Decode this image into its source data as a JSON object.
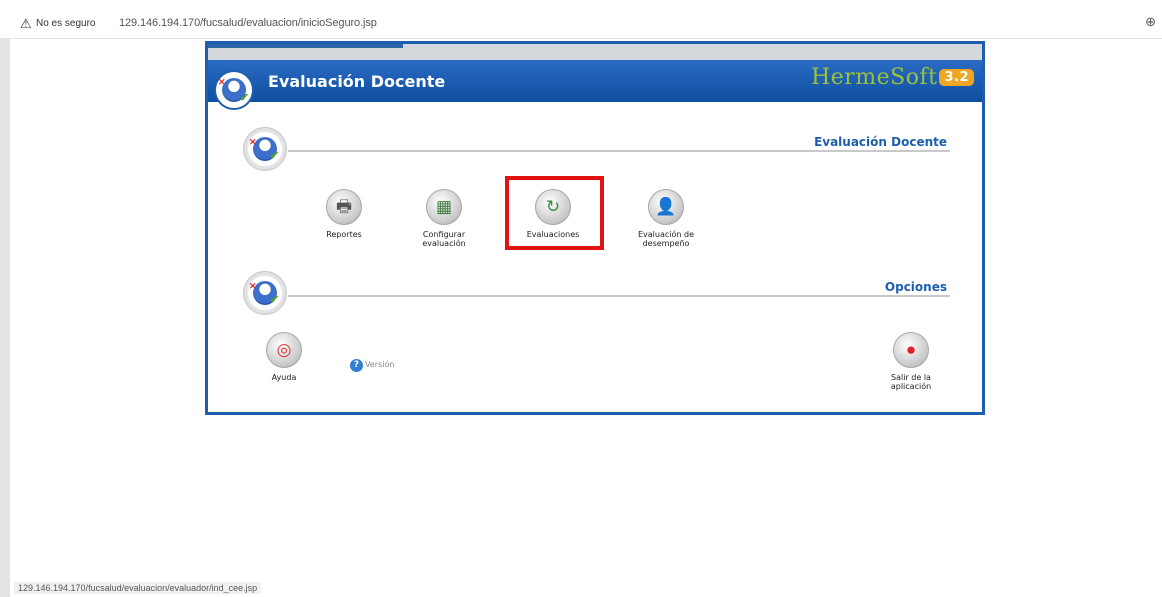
{
  "browser": {
    "security_label": "No es seguro",
    "url": "129.146.194.170/fucsalud/evaluacion/inicioSeguro.jsp",
    "status_url": "129.146.194.170/fucsalud/evaluacion/evaluador/ind_cee.jsp"
  },
  "header": {
    "title": "Evaluación Docente",
    "logo_text": "HermeSoft",
    "logo_version": "3.2"
  },
  "sections": {
    "main_title": "Evaluación Docente",
    "options_title": "Opciones"
  },
  "main_items": [
    {
      "label_line1": "Reportes",
      "label_line2": "",
      "icon": "printer-icon"
    },
    {
      "label_line1": "Configurar",
      "label_line2": "evaluación",
      "icon": "config-icon"
    },
    {
      "label_line1": "Evaluaciones",
      "label_line2": "",
      "icon": "evaluations-icon"
    },
    {
      "label_line1": "Evaluación de",
      "label_line2": "desempeño",
      "icon": "performance-icon"
    }
  ],
  "options": {
    "help_label": "Ayuda",
    "version_label": "Versión",
    "exit_line1": "Salir de la",
    "exit_line2": "aplicación"
  },
  "colors": {
    "brand_blue": "#1d5fae",
    "highlight_red": "#e01212",
    "logo_green": "#9bc23a",
    "logo_orange": "#f0a623"
  }
}
